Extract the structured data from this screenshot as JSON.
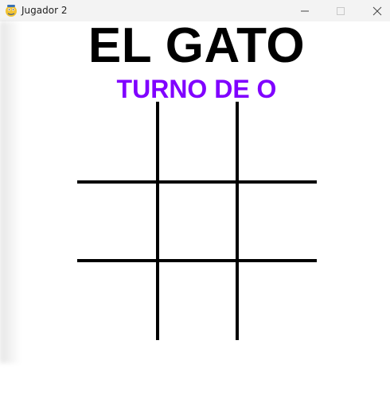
{
  "window": {
    "title": "Jugador 2",
    "icon": "pygame-snake-icon",
    "controls": [
      "minimize-icon",
      "maximize-icon",
      "close-icon"
    ]
  },
  "game": {
    "title": "EL GATO",
    "turn_text": "TURNO DE O",
    "turn_color": "#8000ff",
    "board": [
      [
        "",
        "",
        ""
      ],
      [
        "",
        "",
        ""
      ],
      [
        "",
        "",
        ""
      ]
    ]
  }
}
